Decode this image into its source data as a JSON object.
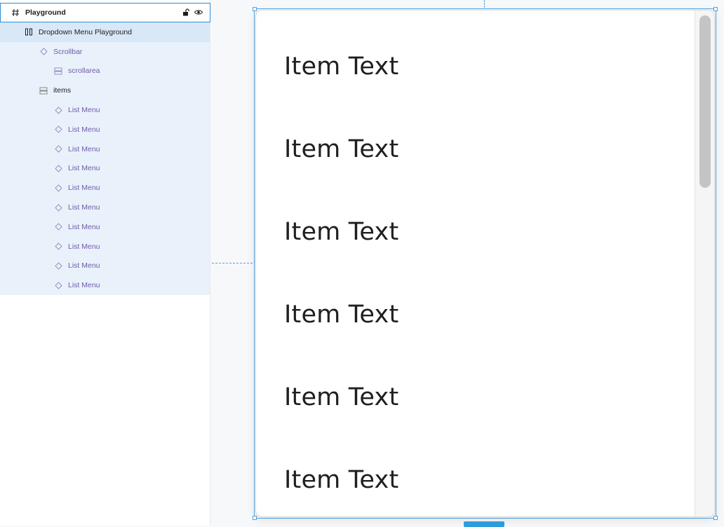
{
  "layers": {
    "root": {
      "label": "Playground",
      "icon": "hash-icon"
    },
    "frame": {
      "label": "Dropdown Menu Playground",
      "icon": "columns-icon"
    },
    "scrollbar": {
      "label": "Scrollbar"
    },
    "scrollarea": {
      "label": "scrollarea"
    },
    "items_group": {
      "label": "items"
    },
    "list_items": [
      "List Menu",
      "List Menu",
      "List Menu",
      "List Menu",
      "List Menu",
      "List Menu",
      "List Menu",
      "List Menu",
      "List Menu",
      "List Menu"
    ]
  },
  "canvas": {
    "items": [
      "Item Text",
      "Item Text",
      "Item Text",
      "Item Text",
      "Item Text",
      "Item Text"
    ]
  },
  "colors": {
    "accent": "#2f8ed6",
    "layer_text": "#6f5aa8",
    "selected_bg": "#d8e8f7"
  }
}
